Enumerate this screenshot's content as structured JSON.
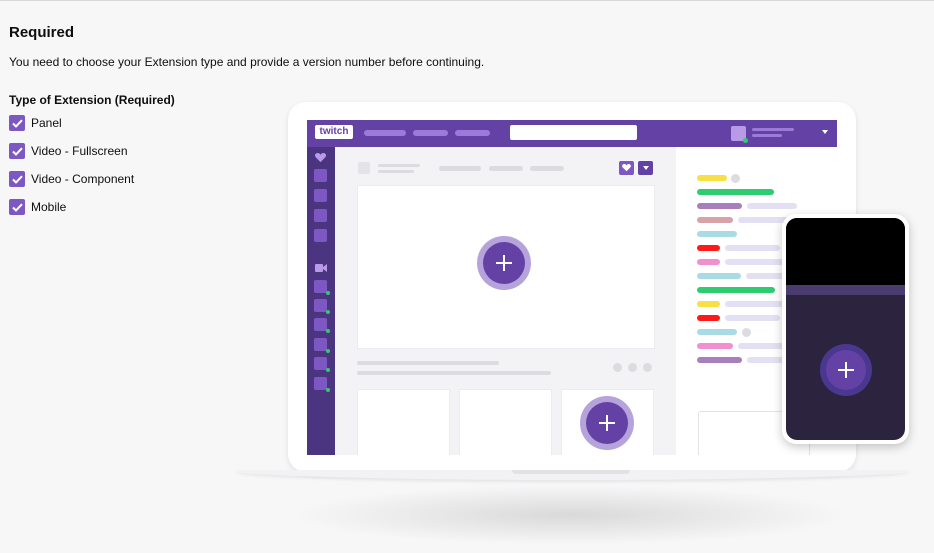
{
  "section": {
    "title": "Required",
    "description": "You need to choose your Extension type and provide a version number before continuing."
  },
  "extension_type": {
    "label": "Type of Extension (Required)",
    "options": [
      {
        "label": "Panel",
        "checked": true
      },
      {
        "label": "Video - Fullscreen",
        "checked": true
      },
      {
        "label": "Video - Component",
        "checked": true
      },
      {
        "label": "Mobile",
        "checked": true
      }
    ]
  },
  "illustration": {
    "logo_text": "twitch",
    "icons": [
      "plus-icon",
      "heart-icon",
      "camera-icon",
      "check-icon"
    ],
    "colors": {
      "brand_purple": "#6441a4",
      "accent_purple": "#7e58c2",
      "mobile_dark": "#2c243f",
      "live_green": "#2ecc71"
    }
  }
}
